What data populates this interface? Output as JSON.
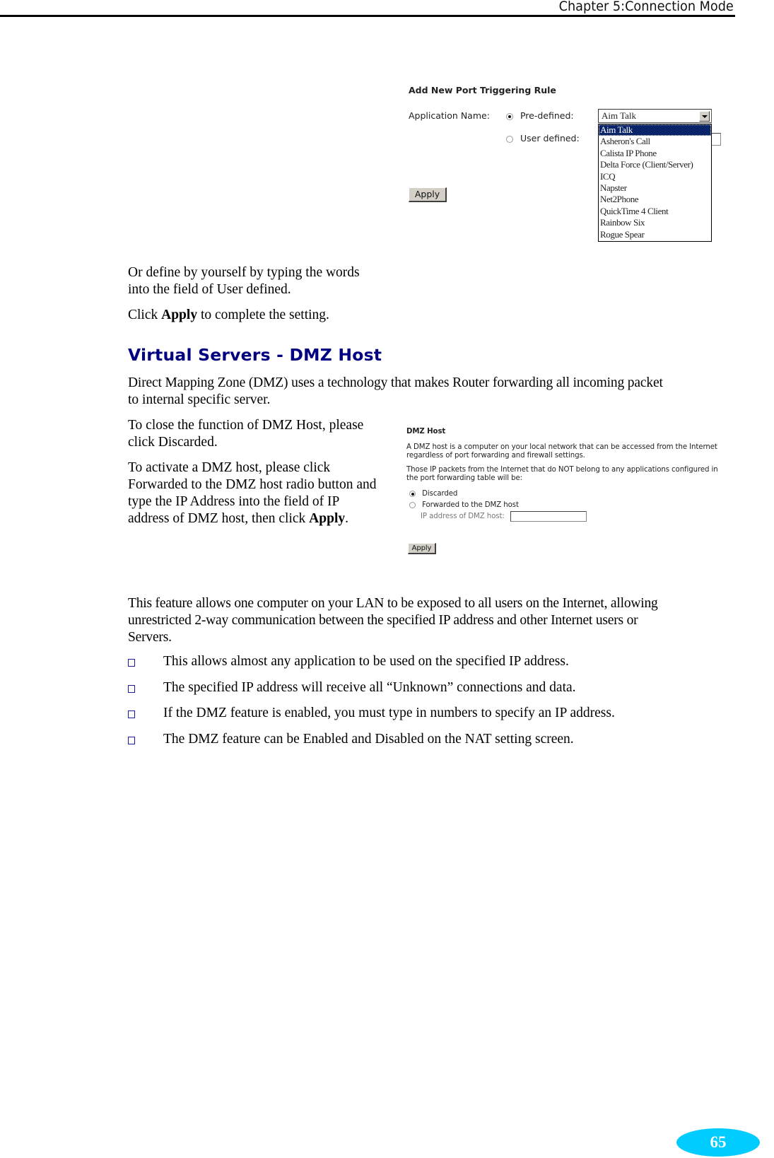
{
  "header": {
    "running_title": "Chapter 5:Connection Mode"
  },
  "port_trigger_ui": {
    "title": "Add New Port Triggering Rule",
    "application_name_label": "Application Name:",
    "predefined_label": "Pre-defined:",
    "user_defined_label": "User defined:",
    "predefined_selected": true,
    "select_value": "Aim Talk",
    "dropdown_options": [
      "Aim Talk",
      "Asheron's Call",
      "Calista IP Phone",
      "Delta Force (Client/Server)",
      "ICQ",
      "Napster",
      "Net2Phone",
      "QuickTime 4 Client",
      "Rainbow Six",
      "Rogue Spear"
    ],
    "highlighted_option": "Aim Talk",
    "apply_label": "Apply"
  },
  "intro": {
    "line1": "Or define by yourself by typing the words",
    "line2": "into the field of User defined.",
    "click_prefix": "Click ",
    "click_bold": "Apply",
    "click_suffix": " to complete the setting."
  },
  "section": {
    "heading": "Virtual Servers - DMZ Host",
    "para1_line1": "Direct Mapping Zone (DMZ) uses a technology that makes Router forwarding all incoming packet",
    "para1_line2": "to internal specific server.",
    "close_line1": "To close the function of DMZ Host, please",
    "close_line2": "click Discarded.",
    "activate_line1": "To activate a DMZ host, please click",
    "activate_line2": "Forwarded to the DMZ host radio button and",
    "activate_line3": "type the IP Address into the field of IP",
    "activate_line4_prefix": "address of DMZ host, then click ",
    "activate_line4_bold": "Apply",
    "activate_line4_suffix": "."
  },
  "dmz_ui": {
    "title": "DMZ Host",
    "desc_line1": "A DMZ host is a computer on your local network that can be accessed from the Internet",
    "desc_line2": "regardless of port forwarding and firewall settings.",
    "packets_line1": "Those IP packets from the Internet that do NOT belong to any applications configured in",
    "packets_line2": "the port forwarding table will be:",
    "option_discarded": "Discarded",
    "option_forwarded": "Forwarded to the DMZ host",
    "discarded_selected": true,
    "ip_label": "IP address of DMZ host:",
    "ip_value": "",
    "apply_label": "Apply"
  },
  "feature": {
    "line1": "This feature allows one computer on your LAN to be exposed to all users on the Internet, allowing",
    "line2": "unrestricted 2-way communication between the specified IP address and other Internet users or",
    "line3": "Servers.",
    "bullets": [
      "This allows almost any application to be used on the specified IP address.",
      "The specified IP address will receive all “Unknown” connections and data.",
      "If the DMZ feature is enabled, you must type in numbers to specify an IP address.",
      "The DMZ feature can be Enabled and Disabled on the NAT setting screen."
    ]
  },
  "footer": {
    "page_number": "65"
  },
  "colors": {
    "heading": "#000080",
    "page_badge": "#00ccff",
    "selection": "#0a246a",
    "bullet_border": "#1a1aa0"
  }
}
